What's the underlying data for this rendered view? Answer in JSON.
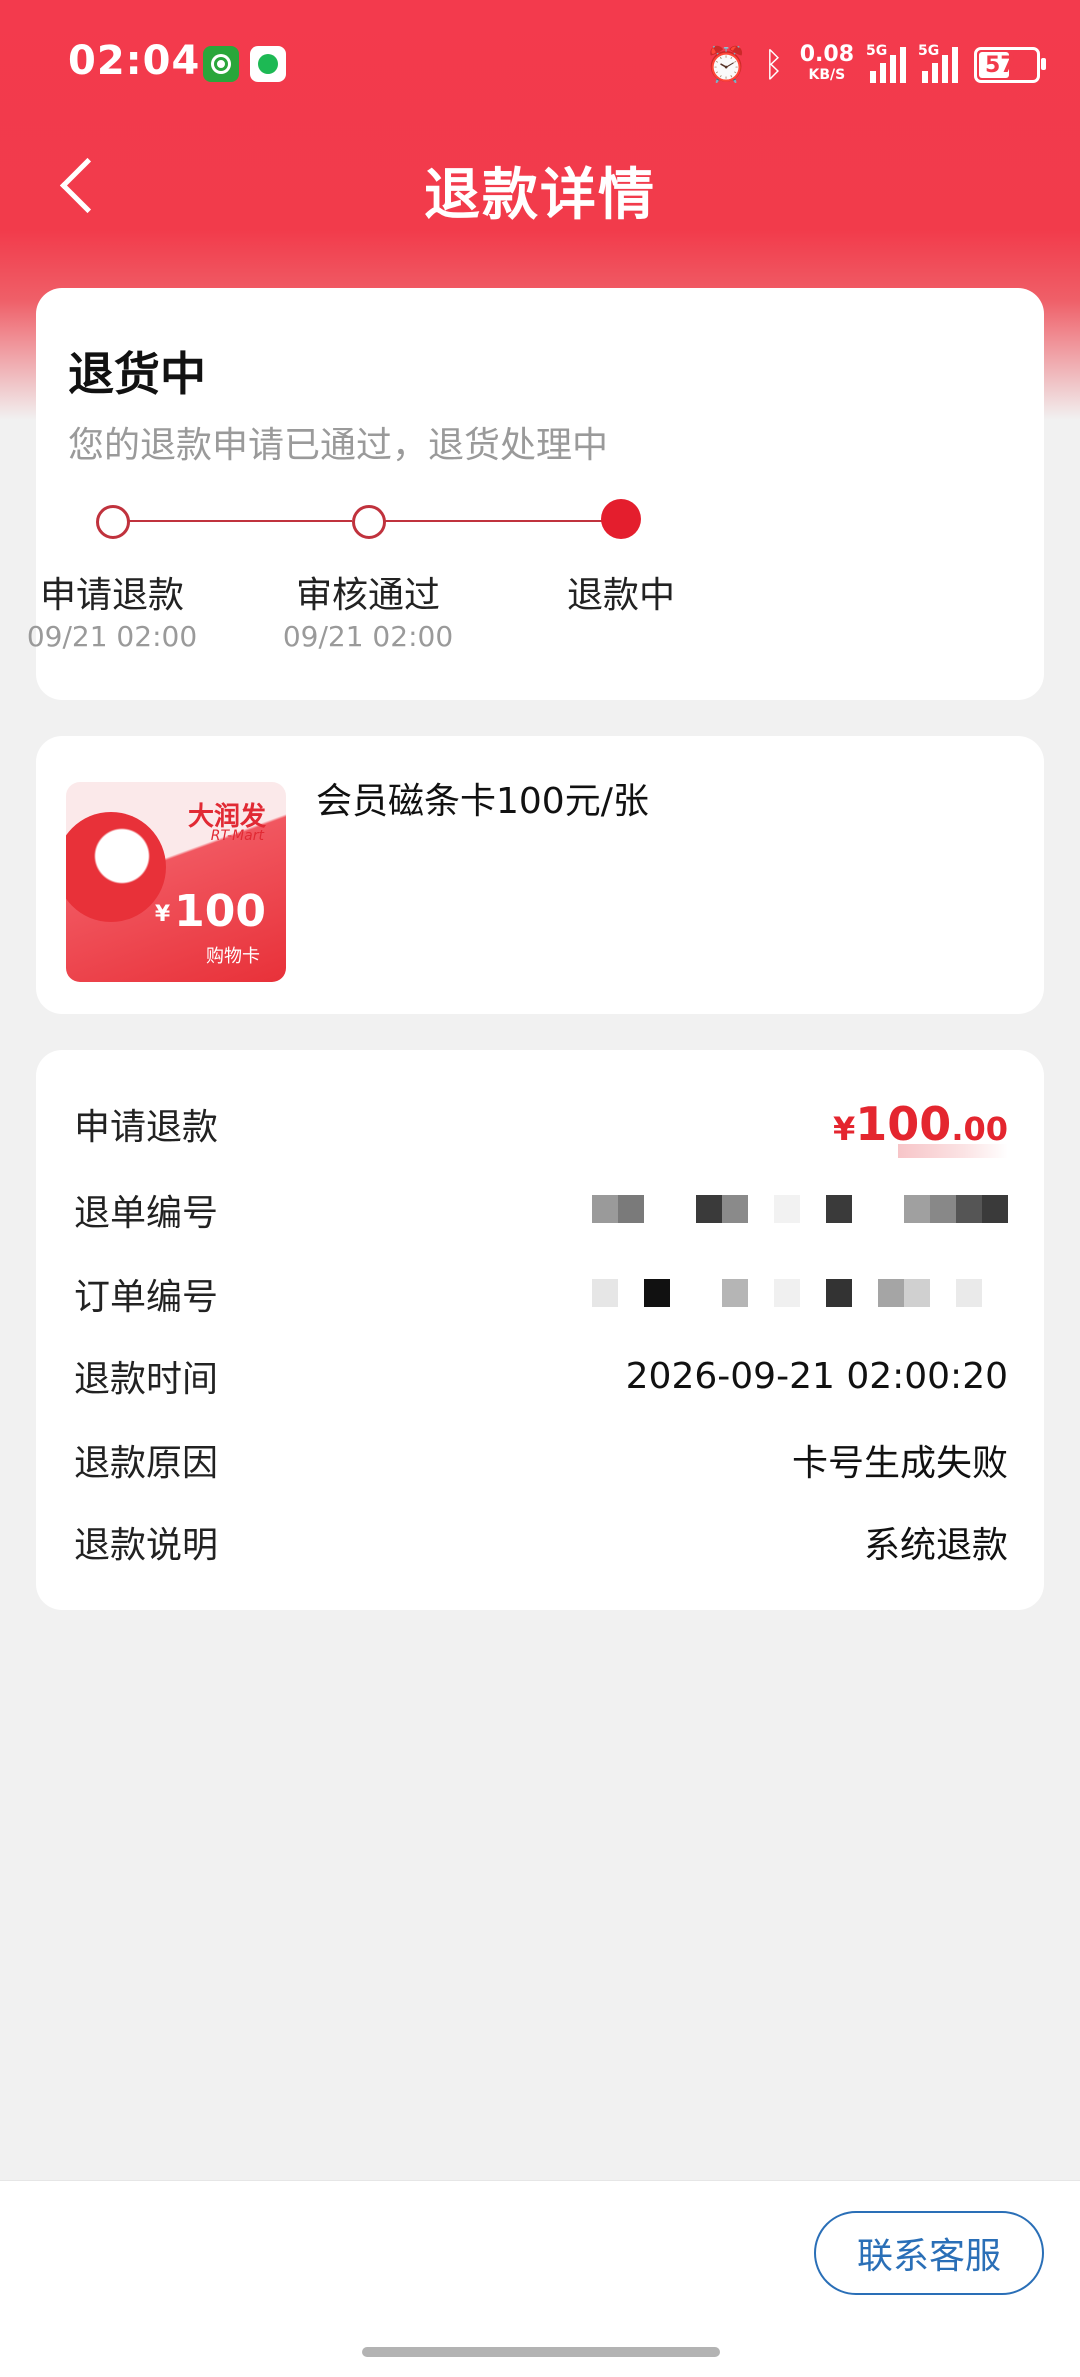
{
  "status_bar": {
    "time": "02:04",
    "net_speed": "0.08",
    "net_unit": "KB/S",
    "signal1_tag": "5G",
    "signal2_tag": "5G",
    "battery": "57",
    "battery_level": 0.57,
    "icons": [
      "app-green-icon",
      "app-chat-icon",
      "alarm-icon",
      "bluetooth-icon",
      "signal-icon",
      "battery-icon"
    ]
  },
  "header": {
    "title": "退款详情"
  },
  "status_card": {
    "title": "退货中",
    "subtitle": "您的退款申请已通过，退货处理中",
    "steps": [
      {
        "label": "申请退款",
        "time": "09/21 02:00"
      },
      {
        "label": "审核通过",
        "time": "09/21 02:00"
      },
      {
        "label": "退款中",
        "time": ""
      }
    ]
  },
  "product": {
    "name": "会员磁条卡100元/张",
    "image": {
      "brand": "大润发",
      "brand_sub": "RT-Mart",
      "currency": "¥",
      "price": "100",
      "type": "购物卡"
    }
  },
  "details": {
    "rows": [
      {
        "label": "申请退款",
        "value": ""
      },
      {
        "label": "退单编号",
        "value": ""
      },
      {
        "label": "订单编号",
        "value": ""
      },
      {
        "label": "退款时间",
        "value": "2026-09-21 02:00:20"
      },
      {
        "label": "退款原因",
        "value": "卡号生成失败"
      },
      {
        "label": "退款说明",
        "value": "系统退款"
      }
    ],
    "amount": {
      "currency": "¥",
      "integer": "100",
      "decimal": ".00"
    }
  },
  "bottom": {
    "contact_label": "联系客服"
  },
  "colors": {
    "brand_red": "#f23b4b",
    "progress_red": "#c0323d",
    "amount_red": "#e4262f",
    "link_blue": "#2a6fb7"
  }
}
